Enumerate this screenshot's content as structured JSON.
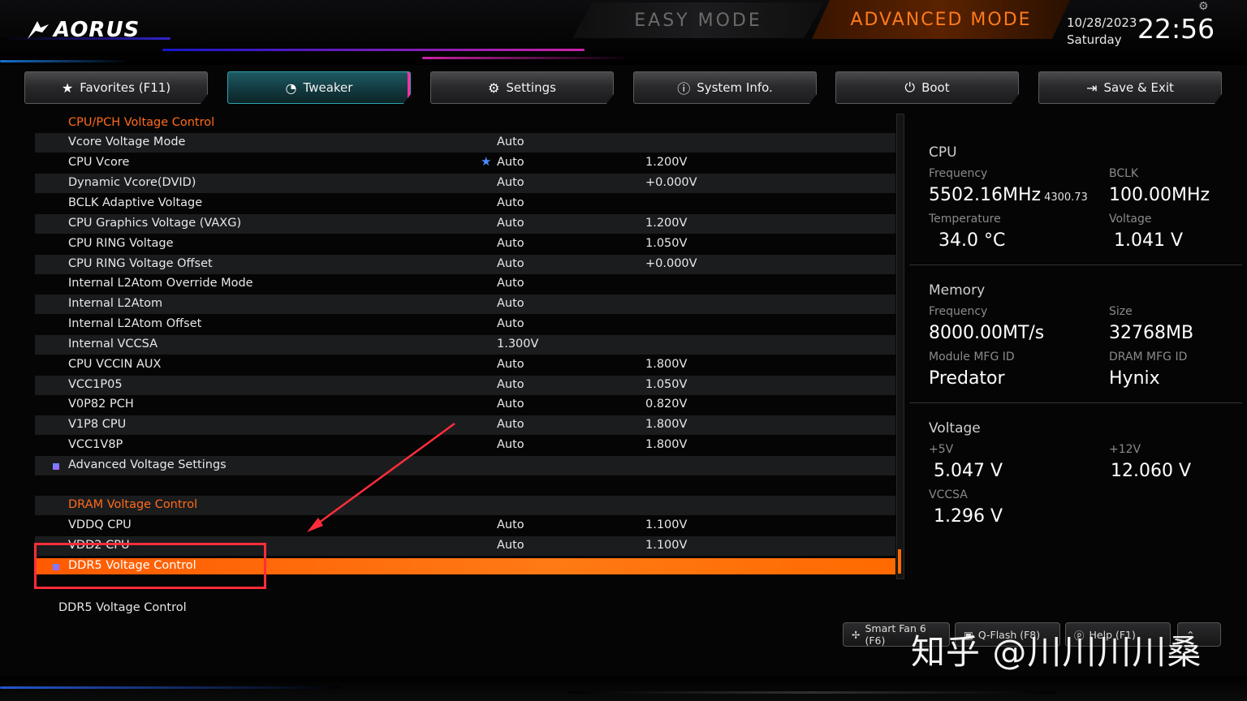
{
  "brand": "AORUS",
  "modes": {
    "easy": "EASY MODE",
    "advanced": "ADVANCED MODE"
  },
  "datetime": {
    "date": "10/28/2023",
    "day": "Saturday",
    "time": "22:56"
  },
  "tabs": [
    {
      "label": "Favorites (F11)",
      "icon": "star-folder-icon"
    },
    {
      "label": "Tweaker",
      "icon": "gauge-icon"
    },
    {
      "label": "Settings",
      "icon": "gear-icon"
    },
    {
      "label": "System Info.",
      "icon": "info-icon"
    },
    {
      "label": "Boot",
      "icon": "power-icon"
    },
    {
      "label": "Save & Exit",
      "icon": "exit-icon"
    }
  ],
  "settings": [
    {
      "label": "CPU/PCH Voltage Control",
      "v1": "",
      "v2": ""
    },
    {
      "label": "Vcore Voltage Mode",
      "v1": "Auto",
      "v2": ""
    },
    {
      "label": "CPU Vcore",
      "v1": "Auto",
      "v2": "1.200V"
    },
    {
      "label": "Dynamic Vcore(DVID)",
      "v1": "Auto",
      "v2": "+0.000V"
    },
    {
      "label": "BCLK Adaptive Voltage",
      "v1": "Auto",
      "v2": ""
    },
    {
      "label": "CPU Graphics Voltage (VAXG)",
      "v1": "Auto",
      "v2": "1.200V"
    },
    {
      "label": "CPU RING Voltage",
      "v1": "Auto",
      "v2": "1.050V"
    },
    {
      "label": "CPU RING Voltage Offset",
      "v1": "Auto",
      "v2": "+0.000V"
    },
    {
      "label": "Internal L2Atom Override Mode",
      "v1": "Auto",
      "v2": ""
    },
    {
      "label": "Internal L2Atom",
      "v1": "Auto",
      "v2": ""
    },
    {
      "label": "Internal L2Atom Offset",
      "v1": "Auto",
      "v2": ""
    },
    {
      "label": "Internal VCCSA",
      "v1": "1.300V",
      "v2": ""
    },
    {
      "label": "CPU VCCIN AUX",
      "v1": "Auto",
      "v2": "1.800V"
    },
    {
      "label": "VCC1P05",
      "v1": "Auto",
      "v2": "1.050V"
    },
    {
      "label": "V0P82 PCH",
      "v1": "Auto",
      "v2": "0.820V"
    },
    {
      "label": "V1P8 CPU",
      "v1": "Auto",
      "v2": "1.800V"
    },
    {
      "label": "VCC1V8P",
      "v1": "Auto",
      "v2": "1.800V"
    },
    {
      "label": "Advanced Voltage Settings",
      "v1": "",
      "v2": ""
    },
    {
      "label": "",
      "v1": "",
      "v2": ""
    },
    {
      "label": "DRAM Voltage Control",
      "v1": "",
      "v2": ""
    },
    {
      "label": "VDDQ CPU",
      "v1": "Auto",
      "v2": "1.100V"
    },
    {
      "label": "VDD2 CPU",
      "v1": "Auto",
      "v2": "1.100V"
    },
    {
      "label": "DDR5 Voltage Control",
      "v1": "",
      "v2": ""
    }
  ],
  "help_text": "DDR5 Voltage Control",
  "info": {
    "cpu": {
      "title": "CPU",
      "freq_label": "Frequency",
      "freq": "5502.16MHz",
      "freq_sub": "4300.73",
      "bclk_label": "BCLK",
      "bclk": "100.00MHz",
      "temp_label": "Temperature",
      "temp": "34.0 °C",
      "volt_label": "Voltage",
      "volt": "1.041 V"
    },
    "memory": {
      "title": "Memory",
      "freq_label": "Frequency",
      "freq": "8000.00MT/s",
      "size_label": "Size",
      "size": "32768MB",
      "module_label": "Module MFG ID",
      "module": "Predator",
      "dram_label": "DRAM MFG ID",
      "dram": "Hynix"
    },
    "voltage": {
      "title": "Voltage",
      "p5_label": "+5V",
      "p5": "5.047 V",
      "p12_label": "+12V",
      "p12": "12.060 V",
      "vccsa_label": "VCCSA",
      "vccsa": "1.296 V"
    }
  },
  "bottom": {
    "smartfan": "Smart Fan 6 (F6)",
    "qflash": "Q-Flash (F8)",
    "help": "Help (F1)"
  },
  "watermark": "知乎 @川川川川桑",
  "colors": {
    "accent": "#ff6a00",
    "section": "#ff6b1a",
    "tab_active": "#2fa4b0",
    "annotation": "#ff2d3a"
  }
}
